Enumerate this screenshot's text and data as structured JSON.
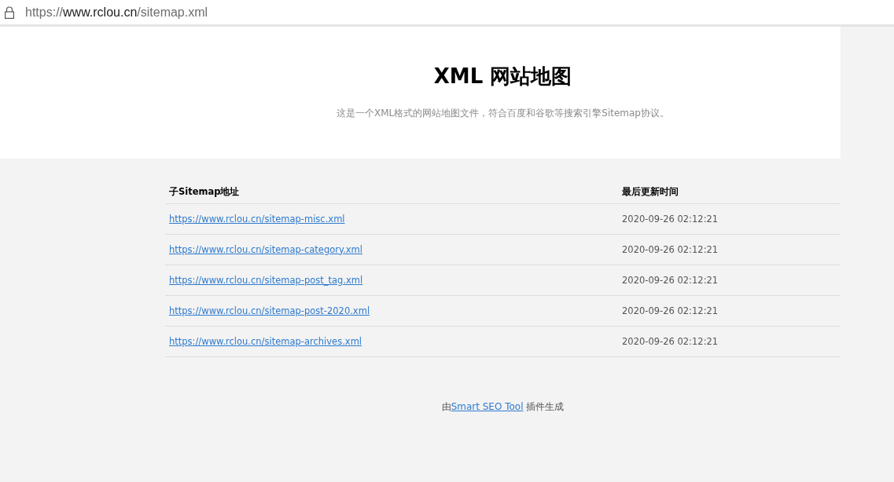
{
  "address_bar": {
    "scheme": "https://",
    "host": "www.rclou.cn",
    "path": "/sitemap.xml"
  },
  "header": {
    "title": "XML 网站地图",
    "description": "这是一个XML格式的网站地图文件，符合百度和谷歌等搜索引擎Sitemap协议。"
  },
  "table": {
    "columns": [
      "子Sitemap地址",
      "最后更新时间"
    ],
    "rows": [
      {
        "url": "https://www.rclou.cn/sitemap-misc.xml",
        "updated": "2020-09-26 02:12:21"
      },
      {
        "url": "https://www.rclou.cn/sitemap-category.xml",
        "updated": "2020-09-26 02:12:21"
      },
      {
        "url": "https://www.rclou.cn/sitemap-post_tag.xml",
        "updated": "2020-09-26 02:12:21"
      },
      {
        "url": "https://www.rclou.cn/sitemap-post-2020.xml",
        "updated": "2020-09-26 02:12:21"
      },
      {
        "url": "https://www.rclou.cn/sitemap-archives.xml",
        "updated": "2020-09-26 02:12:21"
      }
    ]
  },
  "footer": {
    "prefix": "由",
    "link": "Smart SEO Tool",
    "suffix": " 插件生成"
  }
}
